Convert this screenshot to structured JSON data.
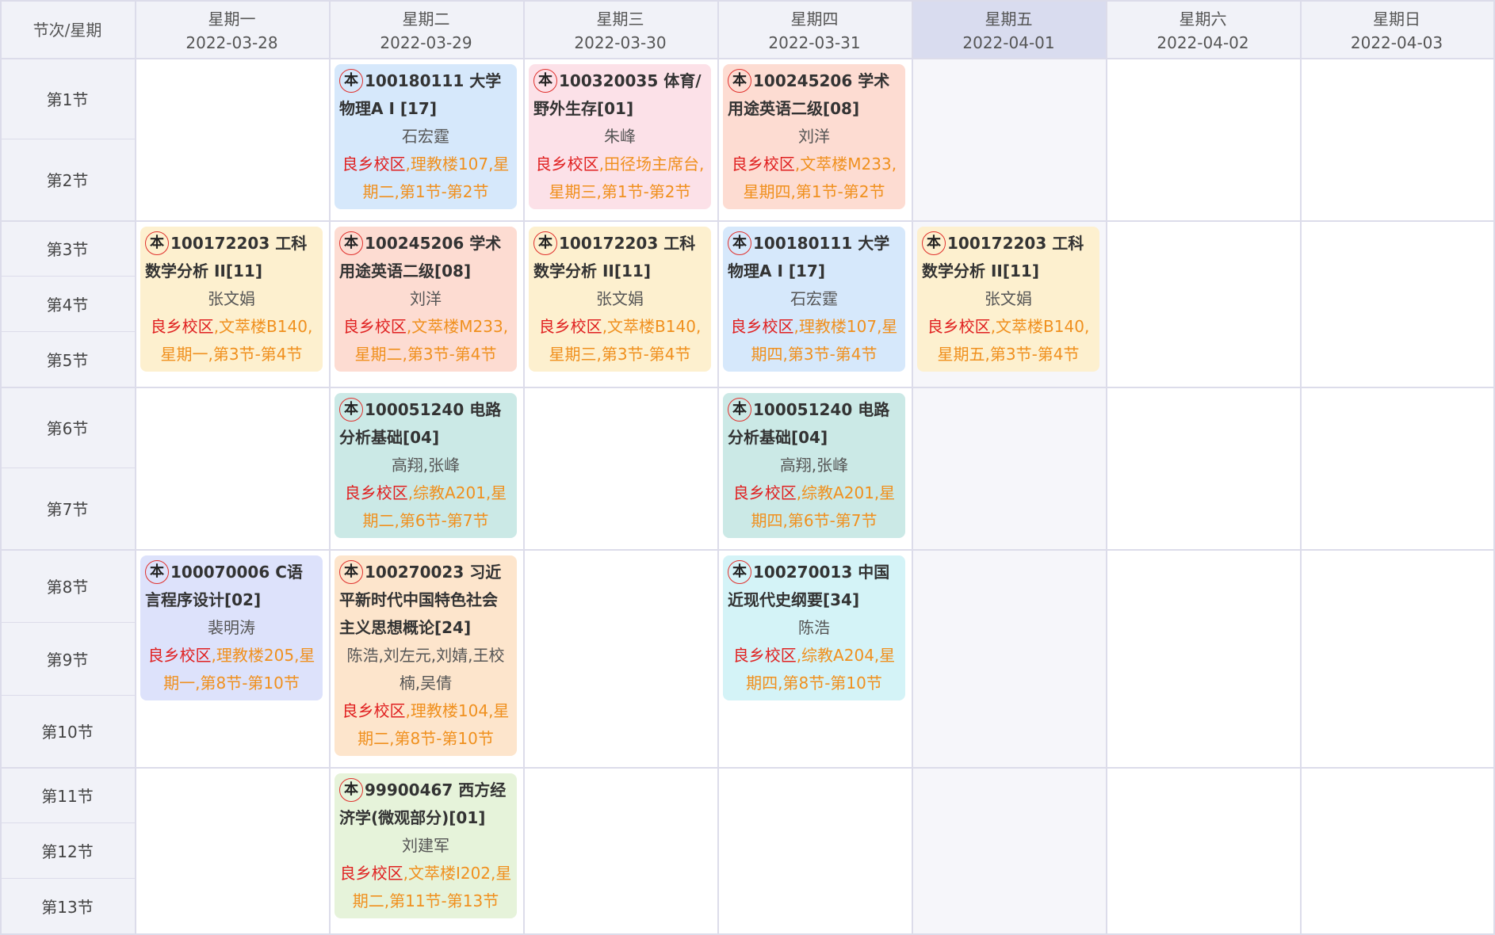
{
  "header": {
    "corner_label": "节次/星期",
    "days": [
      {
        "weekday": "星期一",
        "date": "2022-03-28",
        "today": false
      },
      {
        "weekday": "星期二",
        "date": "2022-03-29",
        "today": false
      },
      {
        "weekday": "星期三",
        "date": "2022-03-30",
        "today": false
      },
      {
        "weekday": "星期四",
        "date": "2022-03-31",
        "today": false
      },
      {
        "weekday": "星期五",
        "date": "2022-04-01",
        "today": true
      },
      {
        "weekday": "星期六",
        "date": "2022-04-02",
        "today": false
      },
      {
        "weekday": "星期日",
        "date": "2022-04-03",
        "today": false
      }
    ]
  },
  "periods": [
    "第1节",
    "第2节",
    "第3节",
    "第4节",
    "第5节",
    "第6节",
    "第7节",
    "第8节",
    "第9节",
    "第10节",
    "第11节",
    "第12节",
    "第13节"
  ],
  "badge_label": "本",
  "colors": {
    "blue": "#d6e8fb",
    "pink": "#fce1e8",
    "salmon": "#fddcd2",
    "yellow": "#fdf0cf",
    "teal": "#cbe9e6",
    "lavender": "#dde2fb",
    "peach": "#fde5cc",
    "cyan": "#d4f3f7",
    "green": "#e6f3da",
    "campus_red": "#e02020",
    "location_orange": "#f0901e",
    "badge_ring": "#e0302c"
  },
  "courses": [
    {
      "day": 1,
      "block": 0,
      "color": "blue",
      "title": "100180111 大学物理A Ⅰ [17]",
      "teacher": "石宏霆",
      "campus": "良乡校区",
      "location": ",理教楼107,星期二,第1节-第2节"
    },
    {
      "day": 2,
      "block": 0,
      "color": "pink",
      "title": "100320035 体育/野外生存[01]",
      "teacher": "朱峰",
      "campus": "良乡校区",
      "location": ",田径场主席台,星期三,第1节-第2节"
    },
    {
      "day": 3,
      "block": 0,
      "color": "salmon",
      "title": "100245206 学术用途英语二级[08]",
      "teacher": "刘洋",
      "campus": "良乡校区",
      "location": ",文萃楼M233,星期四,第1节-第2节"
    },
    {
      "day": 0,
      "block": 1,
      "color": "yellow",
      "title": "100172203 工科数学分析 II[11]",
      "teacher": "张文娟",
      "campus": "良乡校区",
      "location": ",文萃楼B140,星期一,第3节-第4节"
    },
    {
      "day": 1,
      "block": 1,
      "color": "salmon",
      "title": "100245206 学术用途英语二级[08]",
      "teacher": "刘洋",
      "campus": "良乡校区",
      "location": ",文萃楼M233,星期二,第3节-第4节"
    },
    {
      "day": 2,
      "block": 1,
      "color": "yellow",
      "title": "100172203 工科数学分析 II[11]",
      "teacher": "张文娟",
      "campus": "良乡校区",
      "location": ",文萃楼B140,星期三,第3节-第4节"
    },
    {
      "day": 3,
      "block": 1,
      "color": "blue",
      "title": "100180111 大学物理A Ⅰ [17]",
      "teacher": "石宏霆",
      "campus": "良乡校区",
      "location": ",理教楼107,星期四,第3节-第4节"
    },
    {
      "day": 4,
      "block": 1,
      "color": "yellow",
      "title": "100172203 工科数学分析 II[11]",
      "teacher": "张文娟",
      "campus": "良乡校区",
      "location": ",文萃楼B140,星期五,第3节-第4节"
    },
    {
      "day": 1,
      "block": 2,
      "color": "teal",
      "title": "100051240 电路分析基础[04]",
      "teacher": "高翔,张峰",
      "campus": "良乡校区",
      "location": ",综教A201,星期二,第6节-第7节"
    },
    {
      "day": 3,
      "block": 2,
      "color": "teal",
      "title": "100051240 电路分析基础[04]",
      "teacher": "高翔,张峰",
      "campus": "良乡校区",
      "location": ",综教A201,星期四,第6节-第7节"
    },
    {
      "day": 0,
      "block": 3,
      "color": "lavender",
      "title": "100070006 C语言程序设计[02]",
      "teacher": "裴明涛",
      "campus": "良乡校区",
      "location": ",理教楼205,星期一,第8节-第10节"
    },
    {
      "day": 1,
      "block": 3,
      "color": "peach",
      "title": "100270023 习近平新时代中国特色社会主义思想概论[24]",
      "teacher": "陈浩,刘左元,刘婧,王校楠,吴倩",
      "campus": "良乡校区",
      "location": ",理教楼104,星期二,第8节-第10节"
    },
    {
      "day": 3,
      "block": 3,
      "color": "cyan",
      "title": "100270013 中国近现代史纲要[34]",
      "teacher": "陈浩",
      "campus": "良乡校区",
      "location": ",综教A204,星期四,第8节-第10节"
    },
    {
      "day": 1,
      "block": 4,
      "color": "green",
      "title": "99900467 西方经济学(微观部分)[01]",
      "teacher": "刘建军",
      "campus": "良乡校区",
      "location": ",文萃楼I202,星期二,第11节-第13节"
    }
  ]
}
